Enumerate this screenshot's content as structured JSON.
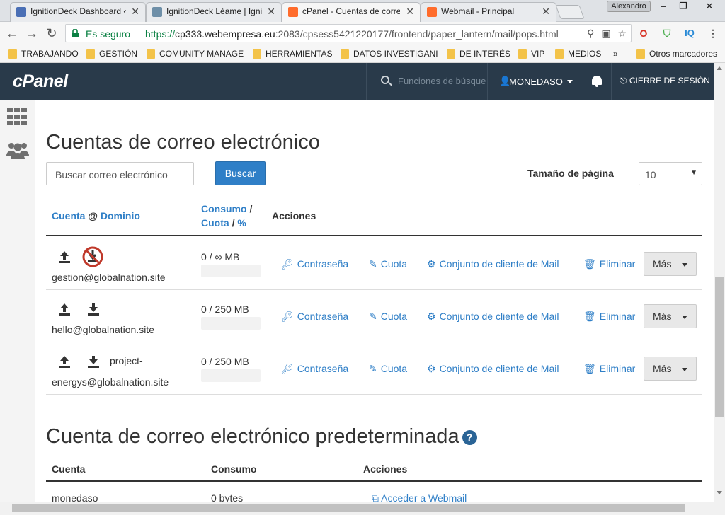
{
  "browser": {
    "tabs": [
      {
        "label": "IgnitionDeck Dashboard ‹",
        "favicon_color": "#4a6fb5"
      },
      {
        "label": "IgnitionDeck Léame | Igni",
        "favicon_color": "#6e8fa8"
      },
      {
        "label": "cPanel - Cuentas de corre",
        "favicon_color": "#ff6c2c"
      },
      {
        "label": "Webmail - Principal",
        "favicon_color": "#ff6c2c"
      }
    ],
    "user_badge": "Alexandro",
    "secure_label": "Es seguro",
    "url_protocol": "https://",
    "url_host": "cp333.webempresa.eu",
    "url_path": ":2083/cpsess5421220177/frontend/paper_lantern/mail/pops.html",
    "bookmarks": [
      "TRABAJANDO",
      "GESTIÓN",
      "COMUNITY MANAGE",
      "HERRAMIENTAS",
      "DATOS INVESTIGANI",
      "DE INTERÉS",
      "VIP",
      "MEDIOS"
    ],
    "bookmarks_more": "»",
    "other_bookmarks": "Otros marcadores"
  },
  "header": {
    "logo": "cPanel",
    "search_placeholder": "Funciones de búsque",
    "username": "MONEDASO",
    "logout": "CIERRE DE SESIÓN"
  },
  "main": {
    "title": "Cuentas de correo electrónico",
    "search_placeholder": "Buscar correo electrónico",
    "search_button": "Buscar",
    "page_size_label": "Tamaño de página",
    "page_size_value": "10",
    "columns": {
      "cuenta": "Cuenta",
      "at": "@",
      "dominio": "Dominio",
      "consumo": "Consumo",
      "slash1": "/",
      "cuota": "Cuota",
      "slash2": "/",
      "pct": "%",
      "acciones": "Acciones"
    },
    "accounts": [
      {
        "email": "gestion@globalnation.site",
        "usage": "0 / ∞ MB",
        "download_disabled": true
      },
      {
        "email": "hello@globalnation.site",
        "usage": "0 / 250 MB",
        "download_disabled": false
      },
      {
        "email_a": "project-",
        "email_b": "energys@globalnation.site",
        "usage": "0 / 250 MB",
        "download_disabled": false
      }
    ],
    "actions": {
      "password": "Contraseña",
      "quota": "Cuota",
      "client": "Conjunto de cliente de Mail",
      "delete": "Eliminar",
      "more": "Más"
    },
    "default_section": {
      "title": "Cuenta de correo electrónico predeterminada",
      "col_cuenta": "Cuenta",
      "col_consumo": "Consumo",
      "col_acciones": "Acciones",
      "row_cuenta": "monedaso",
      "row_consumo": "0 bytes",
      "row_action": "Acceder a Webmail"
    }
  },
  "colors": {
    "header_bg": "#293a4a",
    "link": "#2f7fc7",
    "button": "#2f7fc7",
    "secure": "#0b8043"
  }
}
